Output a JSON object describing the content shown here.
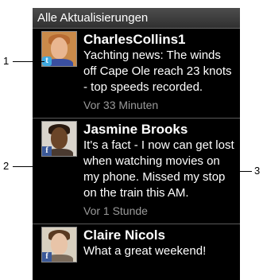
{
  "header": {
    "title": "Alle Aktualisierungen"
  },
  "feed": [
    {
      "name": "CharlesCollins1",
      "text": "Yachting news: The winds off Cape Ole reach 23 knots - top speeds recorded.",
      "time": "Vor 33 Minuten",
      "badge_icon": "twitter-icon",
      "badge_glyph": "t",
      "avatar_colors": {
        "bg": "#c98a4a",
        "face": "#e9b690",
        "hair": "#b86b33",
        "shirt": "#3a4fa0"
      }
    },
    {
      "name": "Jasmine Brooks",
      "text": "It's a fact - I now can get lost when watching movies on my phone. Missed my stop on the train this AM.",
      "time": "Vor 1 Stunde",
      "badge_icon": "facebook-icon",
      "badge_glyph": "f",
      "avatar_colors": {
        "bg": "#d9d4cc",
        "face": "#6b4528",
        "hair": "#2a1a10",
        "shirt": "#4a3a30"
      }
    },
    {
      "name": "Claire Nicols",
      "text": "What a great weekend!",
      "time": "",
      "badge_icon": "facebook-icon",
      "badge_glyph": "f",
      "avatar_colors": {
        "bg": "#d8d0c0",
        "face": "#e8c4a8",
        "hair": "#5a3a22",
        "shirt": "#7a6a5a"
      }
    }
  ],
  "callouts": [
    "1",
    "2",
    "3"
  ]
}
